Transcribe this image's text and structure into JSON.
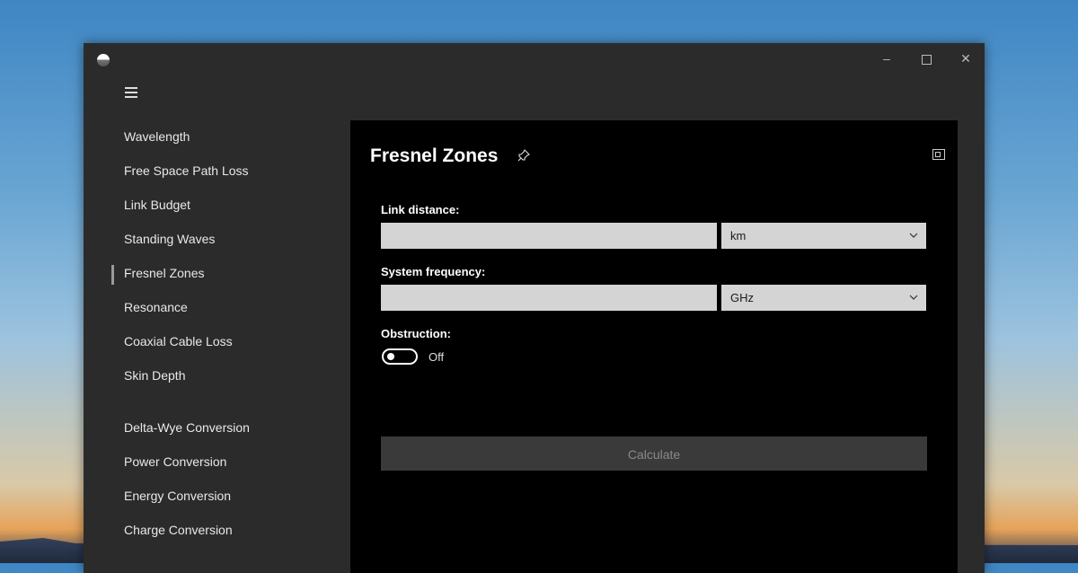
{
  "window": {
    "controls": {
      "minimize": "–",
      "close": "✕"
    }
  },
  "sidebar": {
    "items": [
      {
        "label": "Wavelength"
      },
      {
        "label": "Free Space Path Loss"
      },
      {
        "label": "Link Budget"
      },
      {
        "label": "Standing Waves"
      },
      {
        "label": "Fresnel Zones",
        "active": true
      },
      {
        "label": "Resonance"
      },
      {
        "label": "Coaxial Cable Loss"
      },
      {
        "label": "Skin Depth"
      },
      {
        "label": "Delta-Wye Conversion"
      },
      {
        "label": "Power Conversion"
      },
      {
        "label": "Energy Conversion"
      },
      {
        "label": "Charge Conversion"
      }
    ]
  },
  "page": {
    "title": "Fresnel Zones",
    "link_distance": {
      "label": "Link distance:",
      "value": "",
      "unit": "km"
    },
    "system_frequency": {
      "label": "System frequency:",
      "value": "",
      "unit": "GHz"
    },
    "obstruction": {
      "label": "Obstruction:",
      "state": "Off"
    },
    "calculate_label": "Calculate"
  },
  "icons": [
    "app-icon",
    "hamburger-icon",
    "pin-icon",
    "compact-overlay-icon",
    "chevron-down-icon"
  ]
}
